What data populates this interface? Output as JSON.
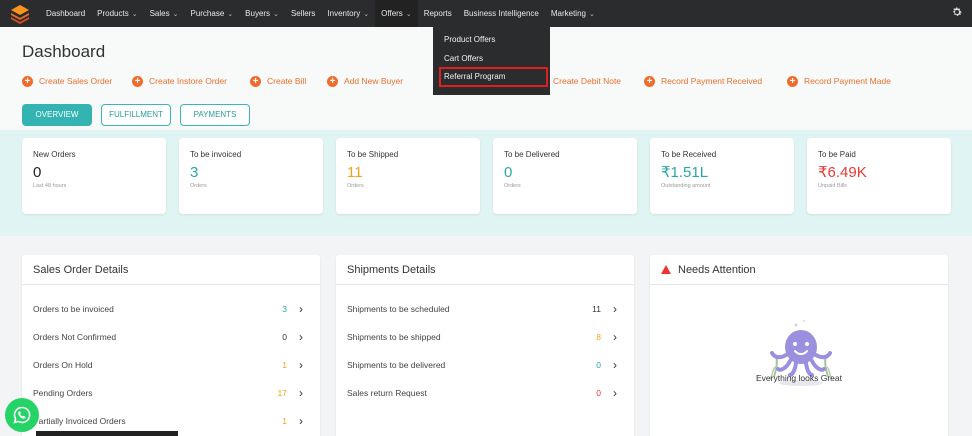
{
  "colors": {
    "accent": "#34b3b3",
    "orange": "#ef6c2c",
    "nav_bg": "#2b2c2e",
    "red": "#e53935"
  },
  "nav": {
    "items": [
      {
        "label": "Dashboard",
        "caret": false
      },
      {
        "label": "Products",
        "caret": true
      },
      {
        "label": "Sales",
        "caret": true
      },
      {
        "label": "Purchase",
        "caret": true
      },
      {
        "label": "Buyers",
        "caret": true
      },
      {
        "label": "Sellers",
        "caret": false
      },
      {
        "label": "Inventory",
        "caret": true
      },
      {
        "label": "Offers",
        "caret": true
      },
      {
        "label": "Reports",
        "caret": false
      },
      {
        "label": "Business Intelligence",
        "caret": false
      },
      {
        "label": "Marketing",
        "caret": true
      }
    ],
    "dropdown": [
      "Product Offers",
      "Cart Offers",
      "Referral Program"
    ]
  },
  "page": {
    "title": "Dashboard"
  },
  "quick_actions": [
    "Create Sales Order",
    "Create Instore Order",
    "Create Bill",
    "Add New Buyer",
    "Create Debit Note",
    "Record Payment Received",
    "Record Payment Made"
  ],
  "tabs": [
    "OVERVIEW",
    "FULFILLMENT",
    "PAYMENTS"
  ],
  "stats": [
    {
      "label": "New Orders",
      "value": "0",
      "sub": "Last 48 hours",
      "color": "#222222"
    },
    {
      "label": "To be invoiced",
      "value": "3",
      "sub": "Orders",
      "color": "#2aa6a6"
    },
    {
      "label": "To be Shipped",
      "value": "11",
      "sub": "Orders",
      "color": "#f0a020"
    },
    {
      "label": "To be Delivered",
      "value": "0",
      "sub": "Orders",
      "color": "#2aa6a6"
    },
    {
      "label": "To be Received",
      "value": "₹1.51L",
      "sub": "Outstanding amount",
      "color": "#2aa6a6"
    },
    {
      "label": "To be Paid",
      "value": "₹6.49K",
      "sub": "Unpaid Bills",
      "color": "#e53935"
    }
  ],
  "sales_panel": {
    "title": "Sales Order Details",
    "rows": [
      {
        "name": "Orders to be invoiced",
        "count": "3",
        "color": "#2aa6a6"
      },
      {
        "name": "Orders Not Confirmed",
        "count": "0",
        "color": "#333333"
      },
      {
        "name": "Orders On Hold",
        "count": "1",
        "color": "#f0a020"
      },
      {
        "name": "Pending Orders",
        "count": "17",
        "color": "#f0a020"
      },
      {
        "name": "Partially Invoiced Orders",
        "count": "1",
        "color": "#f0a020"
      }
    ]
  },
  "shipments_panel": {
    "title": "Shipments Details",
    "rows": [
      {
        "name": "Shipments to be scheduled",
        "count": "11",
        "color": "#333333"
      },
      {
        "name": "Shipments to be shipped",
        "count": "8",
        "color": "#f0a020"
      },
      {
        "name": "Shipments to be delivered",
        "count": "0",
        "color": "#2aa6a6"
      },
      {
        "name": "Sales return Request",
        "count": "0",
        "color": "#e53935"
      }
    ]
  },
  "attention_panel": {
    "title": "Needs Attention",
    "message": "Everything looks Great"
  }
}
